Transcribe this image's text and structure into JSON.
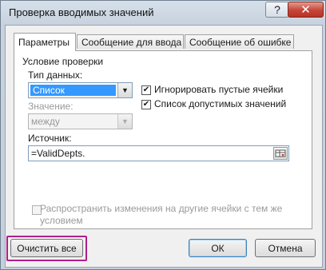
{
  "window": {
    "title": "Проверка вводимых значений",
    "help_glyph": "?",
    "close_glyph": "✕"
  },
  "tabs": [
    {
      "label": "Параметры",
      "active": true
    },
    {
      "label": "Сообщение для ввода",
      "active": false
    },
    {
      "label": "Сообщение об ошибке",
      "active": false
    }
  ],
  "validation": {
    "group_label": "Условие проверки",
    "data_type_label": "Тип данных:",
    "data_type_value": "Список",
    "value_label": "Значение:",
    "value_value": "между",
    "ignore_blank_label": "Игнорировать пустые ячейки",
    "ignore_blank_checked": true,
    "in_cell_dropdown_label": "Список допустимых значений",
    "in_cell_dropdown_checked": true,
    "source_label": "Источник:",
    "source_value": "=ValidDepts."
  },
  "apply_all": {
    "label": "Распространить изменения на другие ячейки с тем же условием",
    "checked": false
  },
  "buttons": {
    "clear_all": "Очистить все",
    "ok": "ОК",
    "cancel": "Отмена"
  }
}
